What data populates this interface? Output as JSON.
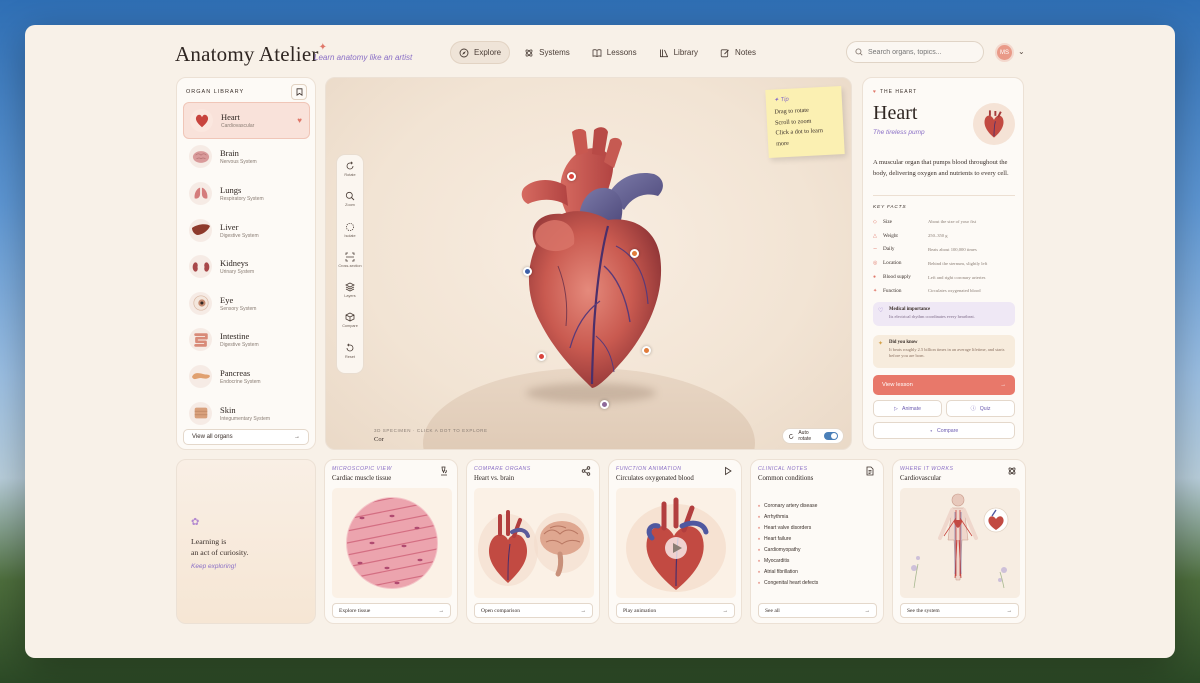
{
  "header": {
    "brand": "Anatomy Atelier",
    "brand_mark": "✦",
    "tagline": "Learn anatomy like an artist",
    "nav": [
      {
        "label": "Explore",
        "icon": "compass-icon",
        "active": true
      },
      {
        "label": "Systems",
        "icon": "atom-icon",
        "active": false
      },
      {
        "label": "Lessons",
        "icon": "book-icon",
        "active": false
      },
      {
        "label": "Library",
        "icon": "library-icon",
        "active": false
      },
      {
        "label": "Notes",
        "icon": "edit-icon",
        "active": false
      }
    ],
    "search_placeholder": "Search organs, topics...",
    "avatar_initials": "MS"
  },
  "organ_library": {
    "title": "ORGAN LIBRARY",
    "items": [
      {
        "name": "Heart",
        "system": "Cardiovascular",
        "active": true,
        "color": "#c8443e"
      },
      {
        "name": "Brain",
        "system": "Nervous System",
        "active": false,
        "color": "#d99a9a"
      },
      {
        "name": "Lungs",
        "system": "Respiratory System",
        "active": false,
        "color": "#d47c7c"
      },
      {
        "name": "Liver",
        "system": "Digestive System",
        "active": false,
        "color": "#8e3a2c"
      },
      {
        "name": "Kidneys",
        "system": "Urinary System",
        "active": false,
        "color": "#a8484a"
      },
      {
        "name": "Eye",
        "system": "Sensory System",
        "active": false,
        "color": "#c48a70"
      },
      {
        "name": "Intestine",
        "system": "Digestive System",
        "active": false,
        "color": "#d88a78"
      },
      {
        "name": "Pancreas",
        "system": "Endocrine System",
        "active": false,
        "color": "#e0a070"
      },
      {
        "name": "Skin",
        "system": "Integumentary System",
        "active": false,
        "color": "#d8a07c"
      }
    ],
    "view_all": "View all organs"
  },
  "viewer": {
    "tools": [
      "Rotate",
      "Zoom",
      "Isolate",
      "Cross-section",
      "Layers",
      "Compare",
      "Reset"
    ],
    "tip": {
      "title": "Tip",
      "lines": [
        "Drag to rotate",
        "Scroll to zoom",
        "Click a dot to learn",
        "more"
      ]
    },
    "specimen_label": "3D SPECIMEN · CLICK A DOT TO EXPLORE",
    "specimen_name": "Cor",
    "auto_rotate": "Auto rotate"
  },
  "detail": {
    "eyebrow": "THE HEART",
    "title": "Heart",
    "subtitle": "The tireless pump",
    "description": "A muscular organ that pumps blood throughout the body, delivering oxygen and nutrients to every cell.",
    "facts_title": "KEY FACTS",
    "facts": [
      {
        "label": "Size",
        "value": "About the size of your fist"
      },
      {
        "label": "Weight",
        "value": "250–350 g"
      },
      {
        "label": "Daily",
        "value": "Beats about 100,000 times"
      },
      {
        "label": "Location",
        "value": "Behind the sternum, slightly left"
      },
      {
        "label": "Blood supply",
        "value": "Left and right coronary arteries"
      },
      {
        "label": "Function",
        "value": "Circulates oxygenated blood"
      }
    ],
    "medical": {
      "title": "Medical importance",
      "text": "Its electrical rhythm coordinates every heartbeat."
    },
    "did_you_know": {
      "title": "Did you know",
      "text": "It beats roughly 2.5 billion times in an average lifetime, and starts before you are born."
    },
    "view_lesson": "View lesson",
    "animate": "Animate",
    "quiz": "Quiz",
    "compare": "Compare"
  },
  "quote": {
    "line1": "Learning is",
    "line2": "an act of curiosity.",
    "sign": "Keep exploring!"
  },
  "cards": {
    "micro": {
      "eyebrow": "MICROSCOPIC VIEW",
      "title": "Cardiac muscle tissue",
      "button": "Explore tissue"
    },
    "compare": {
      "eyebrow": "COMPARE ORGANS",
      "title": "Heart vs. brain",
      "button": "Open comparison"
    },
    "function": {
      "eyebrow": "FUNCTION ANIMATION",
      "title": "Circulates oxygenated blood",
      "button": "Play animation"
    },
    "clinical": {
      "eyebrow": "CLINICAL NOTES",
      "title": "Common conditions",
      "items": [
        "Coronary artery disease",
        "Arrhythmia",
        "Heart valve disorders",
        "Heart failure",
        "Cardiomyopathy",
        "Myocarditis",
        "Atrial fibrillation",
        "Congenital heart defects"
      ],
      "button": "See all"
    },
    "where": {
      "eyebrow": "WHERE IT WORKS",
      "title": "Cardiovascular",
      "button": "See the system"
    }
  }
}
